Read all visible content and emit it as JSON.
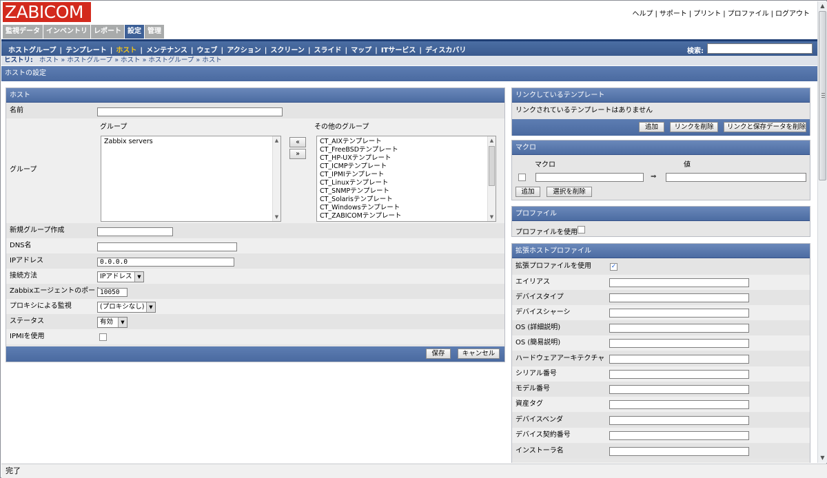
{
  "header": {
    "logo": "ZABICOM",
    "links": [
      "ヘルプ",
      "サポート",
      "プリント",
      "プロファイル",
      "ログアウト"
    ]
  },
  "menu": [
    {
      "label": "監視データ",
      "active": false
    },
    {
      "label": "インベントリ",
      "active": false
    },
    {
      "label": "レポート",
      "active": false
    },
    {
      "label": "設定",
      "active": true
    },
    {
      "label": "管理",
      "active": false
    }
  ],
  "submenu": {
    "items": [
      "ホストグループ",
      "テンプレート",
      "ホスト",
      "メンテナンス",
      "ウェブ",
      "アクション",
      "スクリーン",
      "スライド",
      "マップ",
      "ITサービス",
      "ディスカバリ"
    ],
    "current": "ホスト",
    "search_label": "検索:"
  },
  "history": {
    "label": "ヒストリ:",
    "items": [
      "ホスト",
      "ホストグループ",
      "ホスト",
      "ホストグループ",
      "ホスト"
    ]
  },
  "page_title": "ホストの設定",
  "host_panel": {
    "title": "ホスト",
    "name_label": "名前",
    "name_value": "",
    "group_label": "グループ",
    "groups_header": "グループ",
    "other_groups_header": "その他のグループ",
    "groups": [
      "Zabbix servers"
    ],
    "move_left": "«",
    "move_right": "»",
    "other_groups": [
      "CT_AIXテンプレート",
      "CT_FreeBSDテンプレート",
      "CT_HP-UXテンプレート",
      "CT_ICMPテンプレート",
      "CT_IPMIテンプレート",
      "CT_Linuxテンプレート",
      "CT_SNMPテンプレート",
      "CT_Solarisテンプレート",
      "CT_Windowsテンプレート",
      "CT_ZABICOMテンプレート"
    ],
    "new_group_label": "新規グループ作成",
    "new_group_value": "",
    "dns_label": "DNS名",
    "dns_value": "",
    "ip_label": "IPアドレス",
    "ip_value": "0.0.0.0",
    "connect_label": "接続方法",
    "connect_value": "IPアドレス",
    "port_label": "Zabbixエージェントのポート",
    "port_value": "10050",
    "proxy_label": "プロキシによる監視",
    "proxy_value": "(プロキシなし)",
    "status_label": "ステータス",
    "status_value": "有効",
    "ipmi_label": "IPMIを使用",
    "ipmi_checked": false,
    "save": "保存",
    "cancel": "キャンセル"
  },
  "templates_panel": {
    "title": "リンクしているテンプレート",
    "empty_text": "リンクされているテンプレートはありません",
    "add": "追加",
    "unlink": "リンクを削除",
    "unlink_clear": "リンクと保存データを削除"
  },
  "macro_panel": {
    "title": "マクロ",
    "col_macro": "マクロ",
    "col_value": "値",
    "arrow": "⇒",
    "add": "追加",
    "delete_selected": "選択を削除"
  },
  "profile_panel": {
    "title": "プロファイル",
    "use_label": "プロファイルを使用",
    "checked": false
  },
  "ext_profile_panel": {
    "title": "拡張ホストプロファイル",
    "use_label": "拡張プロファイルを使用",
    "checked": true,
    "fields": [
      "エイリアス",
      "デバイスタイプ",
      "デバイスシャーシ",
      "OS (詳細説明)",
      "OS (簡易説明)",
      "ハードウェアアーキテクチャ",
      "シリアル番号",
      "モデル番号",
      "資産タグ",
      "デバイスベンダ",
      "デバイス契約番号",
      "インストーラ名"
    ]
  },
  "statusbar": "完了"
}
